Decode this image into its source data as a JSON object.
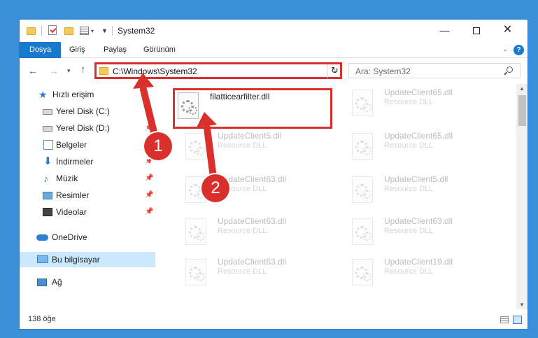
{
  "window": {
    "title": "System32"
  },
  "ribbon": {
    "tabs": [
      "Dosya",
      "Giriş",
      "Paylaş",
      "Görünüm"
    ]
  },
  "address": {
    "path": "C:\\Windows\\System32"
  },
  "search": {
    "placeholder": "Ara: System32"
  },
  "sidebar": {
    "items": [
      {
        "label": "Hızlı erişim",
        "icon": "star-icon"
      },
      {
        "label": "Yerel Disk (C:)",
        "icon": "drive-icon"
      },
      {
        "label": "Yerel Disk (D:)",
        "icon": "drive-icon"
      },
      {
        "label": "Belgeler",
        "icon": "documents-icon"
      },
      {
        "label": "İndirmeler",
        "icon": "downloads-icon"
      },
      {
        "label": "Müzik",
        "icon": "music-icon"
      },
      {
        "label": "Resimler",
        "icon": "pictures-icon"
      },
      {
        "label": "Videolar",
        "icon": "videos-icon"
      },
      {
        "label": "OneDrive",
        "icon": "cloud-icon"
      },
      {
        "label": "Bu bilgisayar",
        "icon": "computer-icon"
      },
      {
        "label": "Ağ",
        "icon": "network-icon"
      }
    ]
  },
  "files": [
    {
      "name": "filatticearfilter.dll",
      "type": ""
    },
    {
      "name": "UpdateClient65.dll",
      "type": "Resource DLL"
    },
    {
      "name": "UpdateClient5.dll",
      "type": "Resource DLL"
    },
    {
      "name": "UpdateClient65.dll",
      "type": "Resource DLL"
    },
    {
      "name": "UpdateClient63.dll",
      "type": "Resource DLL"
    },
    {
      "name": "UpdateClient5.dll",
      "type": "Resource DLL"
    },
    {
      "name": "UpdateClient63.dll",
      "type": "Resource DLL"
    },
    {
      "name": "UpdateClient63.dll",
      "type": "Resource DLL"
    },
    {
      "name": "UpdateClient63.dll",
      "type": "Resource DLL"
    },
    {
      "name": "UpdateClient19.dll",
      "type": "Resource DLL"
    }
  ],
  "status": {
    "count": "138 öğe"
  },
  "annotations": {
    "step1": "1",
    "step2": "2"
  },
  "colors": {
    "accent": "#1979ca",
    "highlight": "#d9302b",
    "selection": "#cce8ff"
  }
}
